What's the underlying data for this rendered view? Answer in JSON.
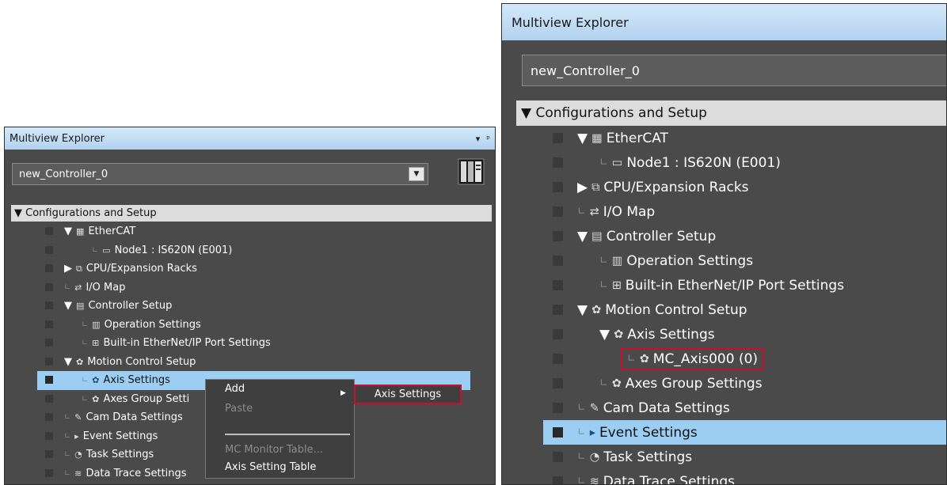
{
  "left": {
    "title": "Multiview Explorer",
    "controls": {
      "dropdown": "▾",
      "pin": "ᵖ"
    },
    "controller": "new_Controller_0",
    "section": "Configurations and Setup",
    "tree": [
      {
        "label": "EtherCAT",
        "twisty": "▼",
        "icon": "▦"
      },
      {
        "label": "Node1 : IS620N (E001)",
        "conn": "∟",
        "icon": "▭"
      },
      {
        "label": "CPU/Expansion Racks",
        "twisty": "▶",
        "icon": "⧉"
      },
      {
        "label": "I/O Map",
        "conn": "∟",
        "icon": "⇄"
      },
      {
        "label": "Controller Setup",
        "twisty": "▼",
        "icon": "▤"
      },
      {
        "label": "Operation Settings",
        "conn": "∟",
        "icon": "▥"
      },
      {
        "label": "Built-in EtherNet/IP Port Settings",
        "conn": "∟",
        "icon": "⊞"
      },
      {
        "label": "Motion Control Setup",
        "twisty": "▼",
        "icon": "✿"
      },
      {
        "label": "Axis Settings",
        "conn": "∟",
        "icon": "✿"
      },
      {
        "label": "Axes Group Setti",
        "conn": "∟",
        "icon": "✿"
      },
      {
        "label": "Cam Data Settings",
        "conn": "∟",
        "icon": "✎"
      },
      {
        "label": "Event Settings",
        "conn": "∟",
        "icon": "▸"
      },
      {
        "label": "Task Settings",
        "conn": "∟",
        "icon": "◔"
      },
      {
        "label": "Data Trace Settings",
        "conn": "∟",
        "icon": "≋"
      }
    ],
    "context_menu": {
      "add": "Add",
      "paste": "Paste",
      "monitor_table": "MC Monitor Table...",
      "axis_setting_table": "Axis Setting Table"
    },
    "submenu": "Axis Settings"
  },
  "right": {
    "title": "Multiview Explorer",
    "controller": "new_Controller_0",
    "section": "Configurations and Setup",
    "tree": [
      {
        "label": "EtherCAT",
        "twisty": "▼",
        "icon": "▦"
      },
      {
        "label": "Node1 : IS620N (E001)",
        "conn": "∟",
        "icon": "▭"
      },
      {
        "label": "CPU/Expansion Racks",
        "twisty": "▶",
        "icon": "⧉"
      },
      {
        "label": "I/O Map",
        "conn": "∟",
        "icon": "⇄"
      },
      {
        "label": "Controller Setup",
        "twisty": "▼",
        "icon": "▤"
      },
      {
        "label": "Operation Settings",
        "conn": "∟",
        "icon": "▥"
      },
      {
        "label": "Built-in EtherNet/IP Port Settings",
        "conn": "∟",
        "icon": "⊞"
      },
      {
        "label": "Motion Control Setup",
        "twisty": "▼",
        "icon": "✿"
      },
      {
        "label": "Axis Settings",
        "twisty": "▼",
        "icon": "✿"
      },
      {
        "label": "MC_Axis000 (0)",
        "conn": "∟",
        "icon": "✿"
      },
      {
        "label": "Axes Group Settings",
        "conn": "∟",
        "icon": "✿"
      },
      {
        "label": "Cam Data Settings",
        "conn": "∟",
        "icon": "✎"
      },
      {
        "label": "Event Settings",
        "conn": "∟",
        "icon": "▸"
      },
      {
        "label": "Task Settings",
        "conn": "∟",
        "icon": "◔"
      },
      {
        "label": "Data Trace Settings",
        "conn": "∟",
        "icon": "≋"
      }
    ]
  },
  "colors": {
    "panel_bg": "#4a4a4a",
    "selection": "#9ccdf2",
    "highlight_border": "#c8102e",
    "title_bar": "#c4ddf4"
  }
}
